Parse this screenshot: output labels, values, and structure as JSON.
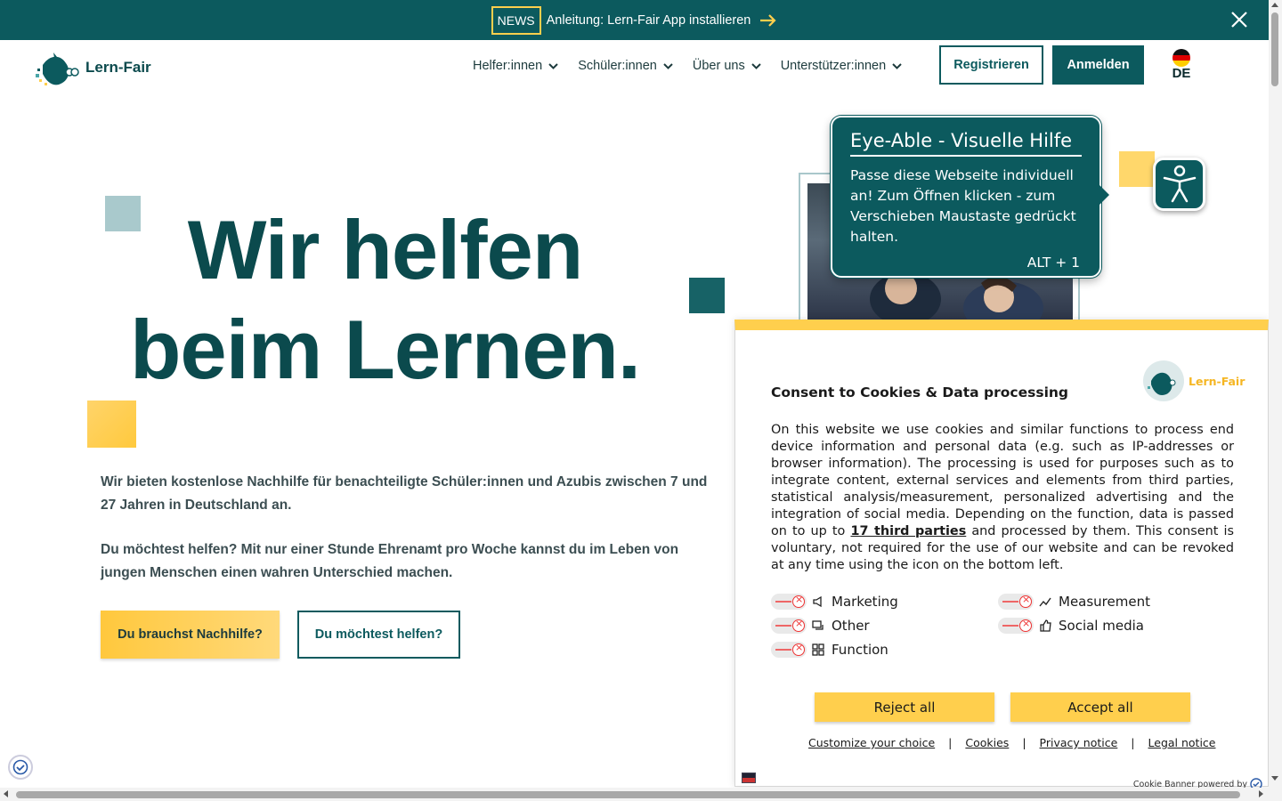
{
  "news": {
    "badge": "NEWS",
    "text": "Anleitung: Lern-Fair App installieren"
  },
  "brand": {
    "name": "Lern-Fair"
  },
  "nav": [
    {
      "label": "Helfer:innen"
    },
    {
      "label": "Schüler:innen"
    },
    {
      "label": "Über uns"
    },
    {
      "label": "Unterstützer:innen"
    }
  ],
  "auth": {
    "register": "Registrieren",
    "login": "Anmelden"
  },
  "language": {
    "code": "DE"
  },
  "hero": {
    "title_line1": "Wir helfen",
    "title_line2": "beim Lernen.",
    "p1": "Wir bieten kostenlose Nachhilfe für benachteiligte Schüler:innen und Azubis zwischen 7 und 27 Jahren in Deutschland an.",
    "p2": "Du möchtest helfen? Mit nur einer Stunde Ehrenamt pro Woche kannst du im Leben von jungen Menschen einen wahren Unterschied machen.",
    "cta_need": "Du brauchst Nachhilfe?",
    "cta_help": "Du möchtest helfen?"
  },
  "eyeable": {
    "title": "Eye-Able - Visuelle Hilfe",
    "body": "Passe diese Webseite individuell an! Zum Öffnen klicken - zum Verschieben Maustaste gedrückt halten.",
    "shortcut": "ALT + 1",
    "icon": "accessibility-person-icon"
  },
  "consent": {
    "title": "Consent to Cookies & Data processing",
    "brand": "Lern-Fair",
    "text_before": "On this website we use cookies and similar functions to process end device information and personal data (e.g. such as IP-addresses or browser information). The processing is used for purposes such as to integrate content, external services and elements from third parties, statistical analysis/measurement, personalized advertising and the integration of social media. Depending on the function, data is passed on to up to ",
    "third_parties": "17 third parties",
    "text_after": " and processed by them. This consent is voluntary, not required for the use of our website and can be revoked at any time using the icon on the bottom left.",
    "options": [
      {
        "label": "Marketing",
        "icon": "megaphone-icon",
        "enabled": false
      },
      {
        "label": "Measurement",
        "icon": "chart-line-icon",
        "enabled": false
      },
      {
        "label": "Other",
        "icon": "chat-bubbles-icon",
        "enabled": false
      },
      {
        "label": "Social media",
        "icon": "thumbs-up-icon",
        "enabled": false
      },
      {
        "label": "Function",
        "icon": "grid-icon",
        "enabled": false
      }
    ],
    "reject": "Reject all",
    "accept": "Accept all",
    "links": [
      "Customize your choice",
      "Cookies",
      "Privacy notice",
      "Legal notice"
    ],
    "powered": "Cookie Banner powered by"
  },
  "colors": {
    "primary": "#0c5a5e",
    "accent": "#ffcf4d"
  }
}
